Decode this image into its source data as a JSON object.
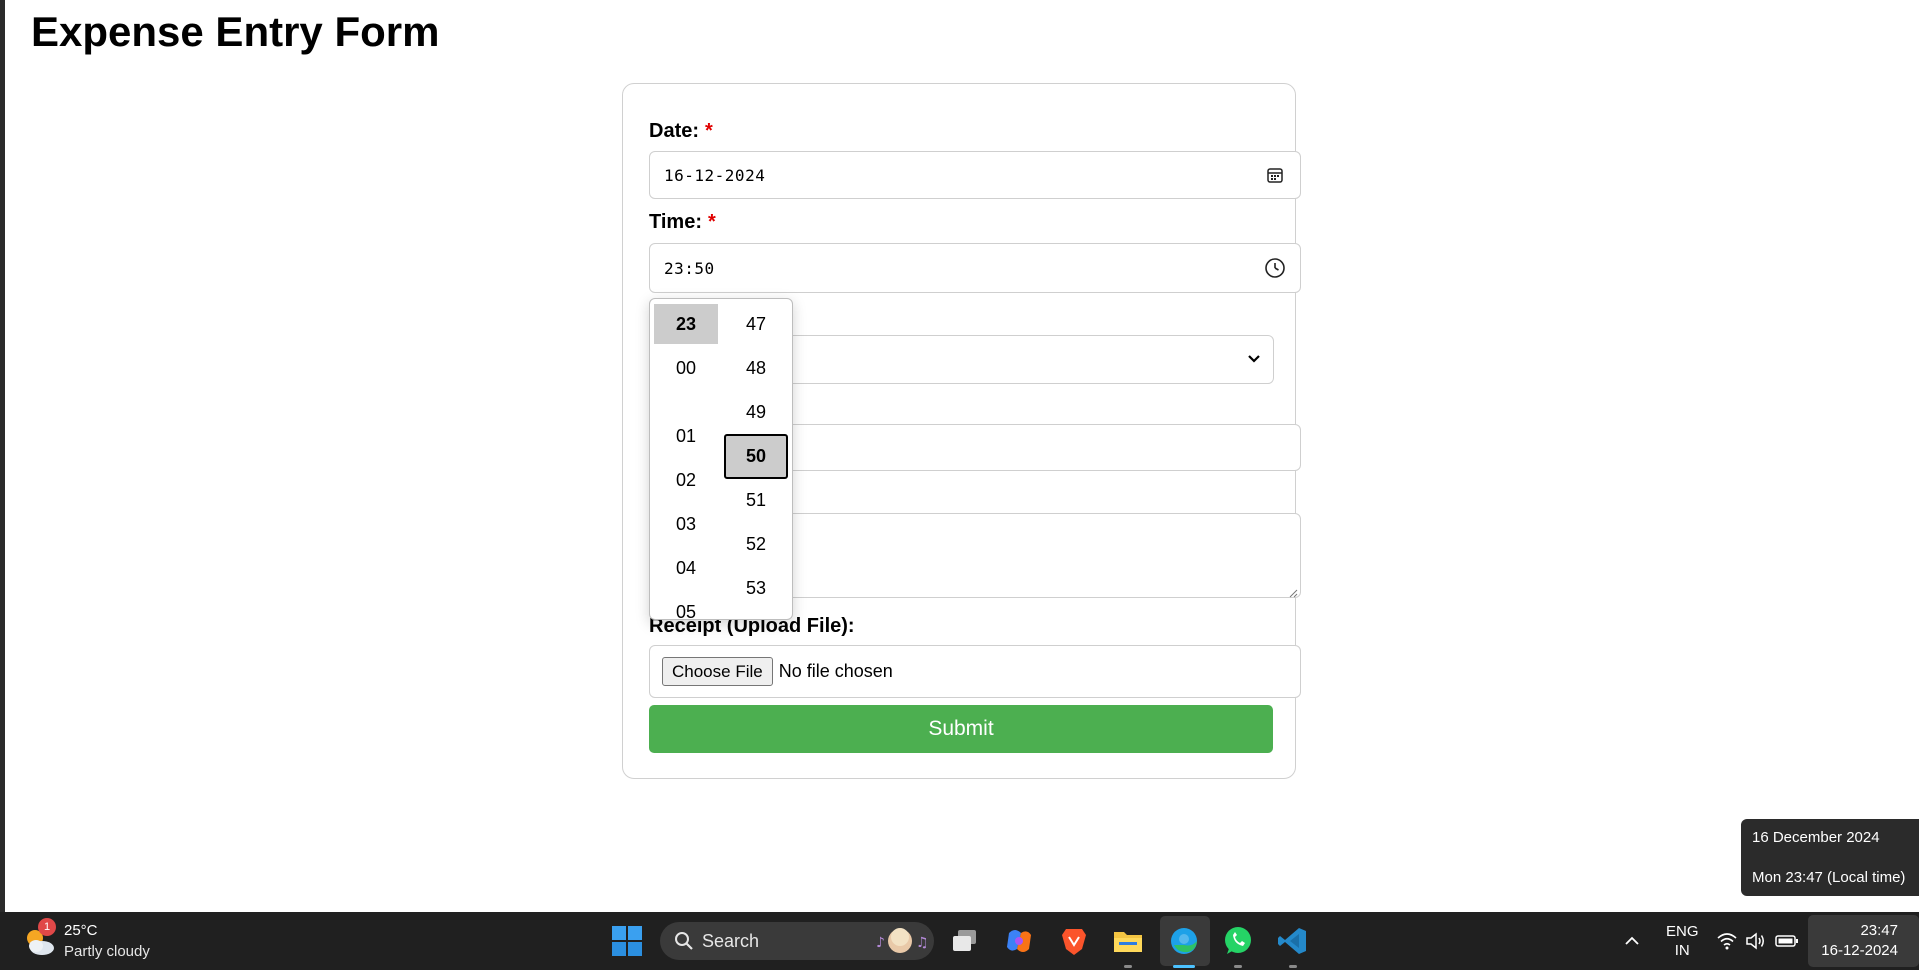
{
  "page": {
    "title": "Expense Entry Form"
  },
  "form": {
    "date": {
      "label": "Date:",
      "required_mark": "*",
      "value": "16-12-2024",
      "icon": "calendar-icon"
    },
    "time": {
      "label": "Time:",
      "required_mark": "*",
      "value": "23:50",
      "icon": "clock-icon"
    },
    "receipt": {
      "label": "Receipt (Upload File):",
      "button_label": "Choose File",
      "status": "No file chosen"
    },
    "submit_label": "Submit"
  },
  "time_picker": {
    "hours": [
      "23",
      "00",
      "01",
      "02",
      "03",
      "04",
      "05"
    ],
    "minutes": [
      "47",
      "48",
      "49",
      "50",
      "51",
      "52",
      "53"
    ],
    "selected_hour": "23",
    "selected_minute": "50"
  },
  "tooltip": {
    "date": "16 December 2024",
    "time": "Mon 23:47 (Local time)"
  },
  "taskbar": {
    "weather": {
      "temp": "25°C",
      "condition": "Partly cloudy",
      "badge": "1"
    },
    "search_label": "Search",
    "apps": [
      "windows-start-icon",
      "task-view-icon",
      "copilot-icon",
      "brave-icon",
      "file-explorer-icon",
      "edge-icon",
      "whatsapp-icon",
      "vscode-icon"
    ],
    "language": {
      "line1": "ENG",
      "line2": "IN"
    },
    "clock": {
      "time": "23:47",
      "date": "16-12-2024"
    },
    "colors": {
      "taskbar": "#202020",
      "submit": "#4caf50",
      "required": "#e00000"
    }
  }
}
